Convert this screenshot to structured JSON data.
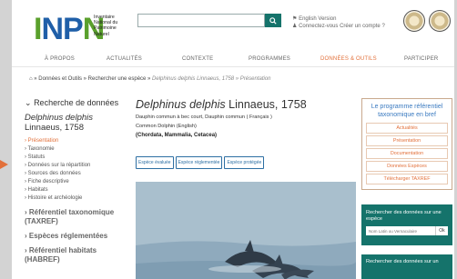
{
  "header": {
    "logo_letters": [
      "I",
      "N",
      "P",
      "N"
    ],
    "logo_lines": [
      "Inventaire",
      "National du",
      "Patrimoine",
      "Naturel"
    ],
    "search_placeholder": "",
    "english_link": "English Version",
    "account_links": "Connectez-vous Créer un compte ?"
  },
  "nav": [
    "À PROPOS",
    "ACTUALITÉS",
    "CONTEXTE",
    "PROGRAMMES",
    "DONNÉES & OUTILS",
    "PARTICIPER"
  ],
  "nav_active_index": 4,
  "breadcrumb": {
    "path": "» Données et Outils » Rechercher une espèce » ",
    "species": "Delphinus delphis",
    "author": "Linnaeus, 1758",
    "tail": " » Présentation"
  },
  "sidebar": {
    "title": "Recherche de données",
    "species_italic": "Delphinus delphis",
    "species_author": "Linnaeus, 1758",
    "links": [
      "Présentation",
      "Taxonomie",
      "Statuts",
      "Données sur la répartition",
      "Sources des données",
      "Fiche descriptive",
      "Habitats",
      "Histoire et archéologie"
    ],
    "active_link_index": 0,
    "sections": [
      "Référentiel taxonomique (TAXREF)",
      "Espèces réglementées",
      "Référentiel habitats (HABREF)"
    ]
  },
  "main": {
    "species_italic": "Delphinus delphis",
    "species_author": "Linnaeus, 1758",
    "common_fr": "Dauphin commun à bec court, Dauphin commun ( Français )",
    "common_en": "Common Dolphin (English)",
    "taxonomy": "(Chordata, Mammalia, Cetacea)",
    "tags": [
      "Espèce évaluée",
      "Espèce réglementée",
      "Espèce protégée"
    ]
  },
  "right": {
    "program_title": "Le programme référentiel taxonomique en bref",
    "program_buttons": [
      "Actualités",
      "Présentation",
      "Documentation",
      "Données Espèces",
      "Télécharger TAXREF"
    ],
    "search_title": "Rechercher des données sur une espèce",
    "search_placeholder": "Nom Latin ou Vernaculaire",
    "search_ok": "Ok",
    "search2_title": "Rechercher des données sur un"
  },
  "colors": {
    "accent": "#e2703a",
    "teal": "#15736b",
    "link_blue": "#2d6fa3",
    "logo_green": "#5aa02c",
    "logo_blue": "#1f5fa8"
  },
  "icons": {
    "search": "search-icon",
    "flag": "flag-icon",
    "user": "user-icon",
    "home": "home-icon",
    "chevron": "chevron-down-icon"
  }
}
